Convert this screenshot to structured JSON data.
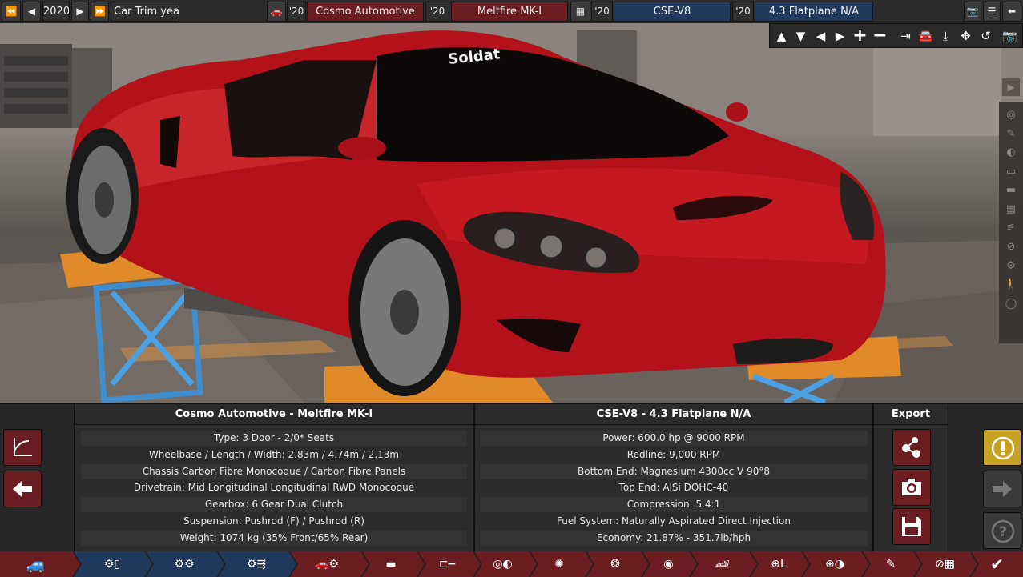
{
  "topbar": {
    "year": "2020",
    "trim_year_label": "Car Trim year",
    "company_year": "'20",
    "company": "Cosmo Automotive",
    "model_year": "'20",
    "model": "Meltfire MK-I",
    "engine_family_year": "'20",
    "engine_family": "CSE-V8",
    "engine_variant_year": "'20",
    "engine_variant": "4.3 Flatplane N/A"
  },
  "scene": {
    "car_decal": "Soldat",
    "car_color": "#b3121a"
  },
  "car_panel": {
    "title": "Cosmo Automotive - Meltfire MK-I",
    "rows": [
      "Type: 3 Door - 2/0* Seats",
      "Wheelbase / Length / Width: 2.83m / 4.74m / 2.13m",
      "Chassis Carbon Fibre Monocoque / Carbon Fibre Panels",
      "Drivetrain: Mid Longitudinal Longitudinal RWD Monocoque",
      "Gearbox: 6 Gear Dual Clutch",
      "Suspension: Pushrod (F) / Pushrod (R)",
      "Weight: 1074 kg (35% Front/65% Rear)"
    ]
  },
  "engine_panel": {
    "title": "CSE-V8 - 4.3 Flatplane N/A",
    "rows": [
      "Power: 600.0 hp @ 9000 RPM",
      "Redline:  9,000 RPM",
      "Bottom End: Magnesium 4300cc V 90°8",
      "Top End: AlSi DOHC-40",
      "Compression: 5.4:1",
      "Fuel System: Naturally Aspirated Direct Injection",
      "Economy: 21.87% - 351.7lb/hph"
    ]
  },
  "export_panel": {
    "title": "Export"
  },
  "colors": {
    "accent_red": "#6b1e22",
    "accent_blue": "#1f3a5c",
    "warning_yellow": "#c7a222"
  }
}
